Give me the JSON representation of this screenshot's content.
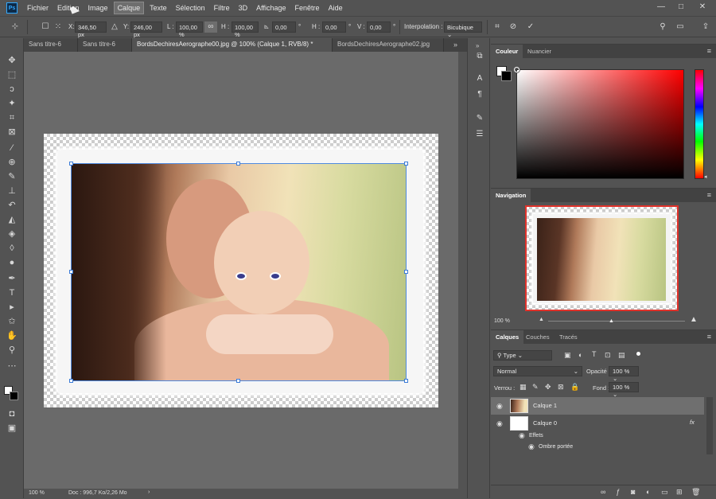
{
  "menu": {
    "logo": "Ps",
    "items": [
      "Fichier",
      "Edition",
      "Image",
      "Calque",
      "Texte",
      "Sélection",
      "Filtre",
      "3D",
      "Affichage",
      "Fenêtre",
      "Aide"
    ],
    "active": "Calque"
  },
  "window_controls": {
    "minimize": "—",
    "maximize": "□",
    "close": "✕"
  },
  "options_bar": {
    "x_label": "X:",
    "x_value": "346,50 px",
    "y_label": "Y:",
    "y_value": "246,00 px",
    "w_label": "L :",
    "w_value": "100,00 %",
    "h_label": "H :",
    "h_value": "100,00 %",
    "angle_value": "0,00",
    "hskew_label": "H :",
    "hskew_value": "0,00",
    "vskew_label": "V :",
    "vskew_value": "0,00",
    "degree": "°",
    "interp_label": "Interpolation :",
    "interp_value": "Bicubique"
  },
  "tabs": [
    {
      "label": "Sans titre-6"
    },
    {
      "label": "Sans titre-6"
    },
    {
      "label": "BordsDechiresAerographe00.jpg @ 100% (Calque 1, RVB/8) *"
    },
    {
      "label": "BordsDechiresAerographe02.jpg"
    }
  ],
  "active_tab_index": 2,
  "status": {
    "zoom": "100 %",
    "doc": "Doc : 996,7 Ko/2,26 Mo"
  },
  "color_panel": {
    "tabs": [
      "Couleur",
      "Nuancier"
    ]
  },
  "navigation_panel": {
    "tab": "Navigation",
    "zoom": "100 %"
  },
  "layers_panel": {
    "tabs": [
      "Calques",
      "Couches",
      "Tracés"
    ],
    "filter": "Type",
    "blend_mode": "Normal",
    "opacity_label": "Opacité :",
    "opacity_value": "100 %",
    "lock_label": "Verrou :",
    "fill_label": "Fond :",
    "fill_value": "100 %",
    "layers": [
      {
        "name": "Calque 1",
        "selected": true
      },
      {
        "name": "Calque 0",
        "selected": false,
        "fx": "fx"
      }
    ],
    "effects_label": "Effets",
    "effect_item": "Ombre portée"
  }
}
